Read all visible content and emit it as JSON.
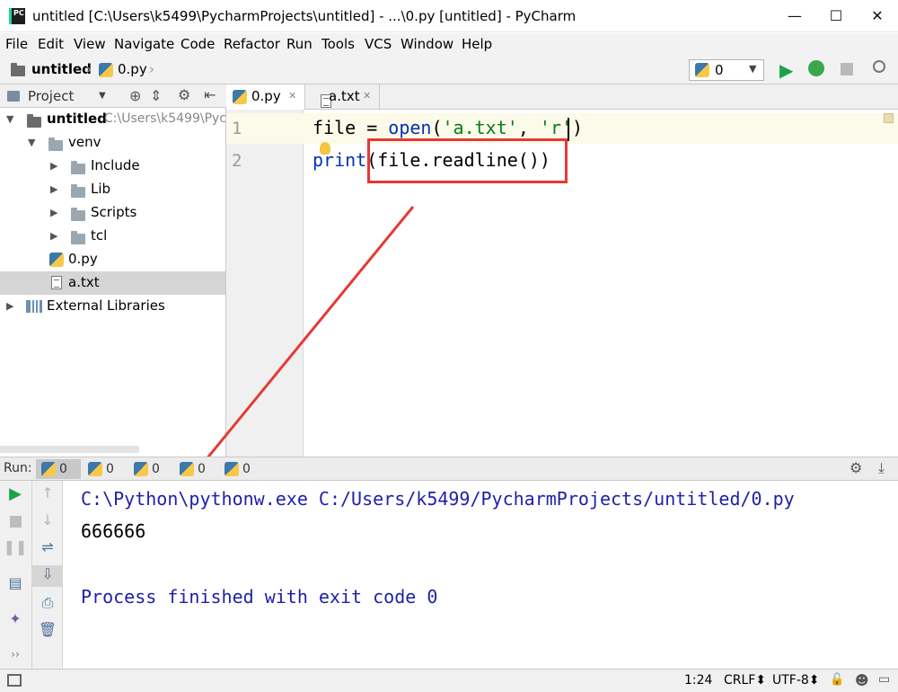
{
  "window": {
    "title": "untitled [C:\\Users\\k5499\\PycharmProjects\\untitled] - ...\\0.py [untitled] - PyCharm",
    "app_icon_text": "PC",
    "controls": {
      "minimize": "—",
      "maximize": "☐",
      "close": "✕"
    }
  },
  "menu": [
    "File",
    "Edit",
    "View",
    "Navigate",
    "Code",
    "Refactor",
    "Run",
    "Tools",
    "VCS",
    "Window",
    "Help"
  ],
  "breadcrumb": {
    "project": "untitled",
    "file": "0.py"
  },
  "run_config": {
    "value": "0"
  },
  "project_panel": {
    "title": "Project",
    "items": [
      {
        "label": "untitled",
        "path": "C:\\Users\\k5499\\Pyc"
      },
      {
        "label": "venv"
      },
      {
        "label": "Include"
      },
      {
        "label": "Lib"
      },
      {
        "label": "Scripts"
      },
      {
        "label": "tcl"
      },
      {
        "label": "0.py"
      },
      {
        "label": "a.txt"
      },
      {
        "label": "External Libraries"
      }
    ]
  },
  "editor": {
    "tabs": [
      "0.py",
      "a.txt"
    ],
    "line_numbers": [
      "1",
      "2"
    ],
    "lines": {
      "l1_a": "file",
      "l1_b": " = ",
      "l1_c": "open",
      "l1_d": "(",
      "l1_e": "'a.txt'",
      "l1_f": ", ",
      "l1_g": "'r'",
      "l1_h": ")",
      "l2_a": "print",
      "l2_b": "(file.readline())"
    }
  },
  "run": {
    "label": "Run:",
    "tabs": [
      "0",
      "0",
      "0",
      "0",
      "0"
    ],
    "console": {
      "command": "C:\\Python\\pythonw.exe C:/Users/k5499/PycharmProjects/untitled/0.py",
      "output": "666666",
      "finish": "Process finished with exit code 0"
    }
  },
  "statusbar": {
    "position": "1:24",
    "line_sep": "CRLF⬍",
    "encoding": "UTF-8⬍"
  },
  "colors": {
    "highlight_box": "#e53935",
    "keyword_blue": "#0033b3",
    "string_green": "#067d17",
    "console_blue": "#1f1fa8"
  }
}
